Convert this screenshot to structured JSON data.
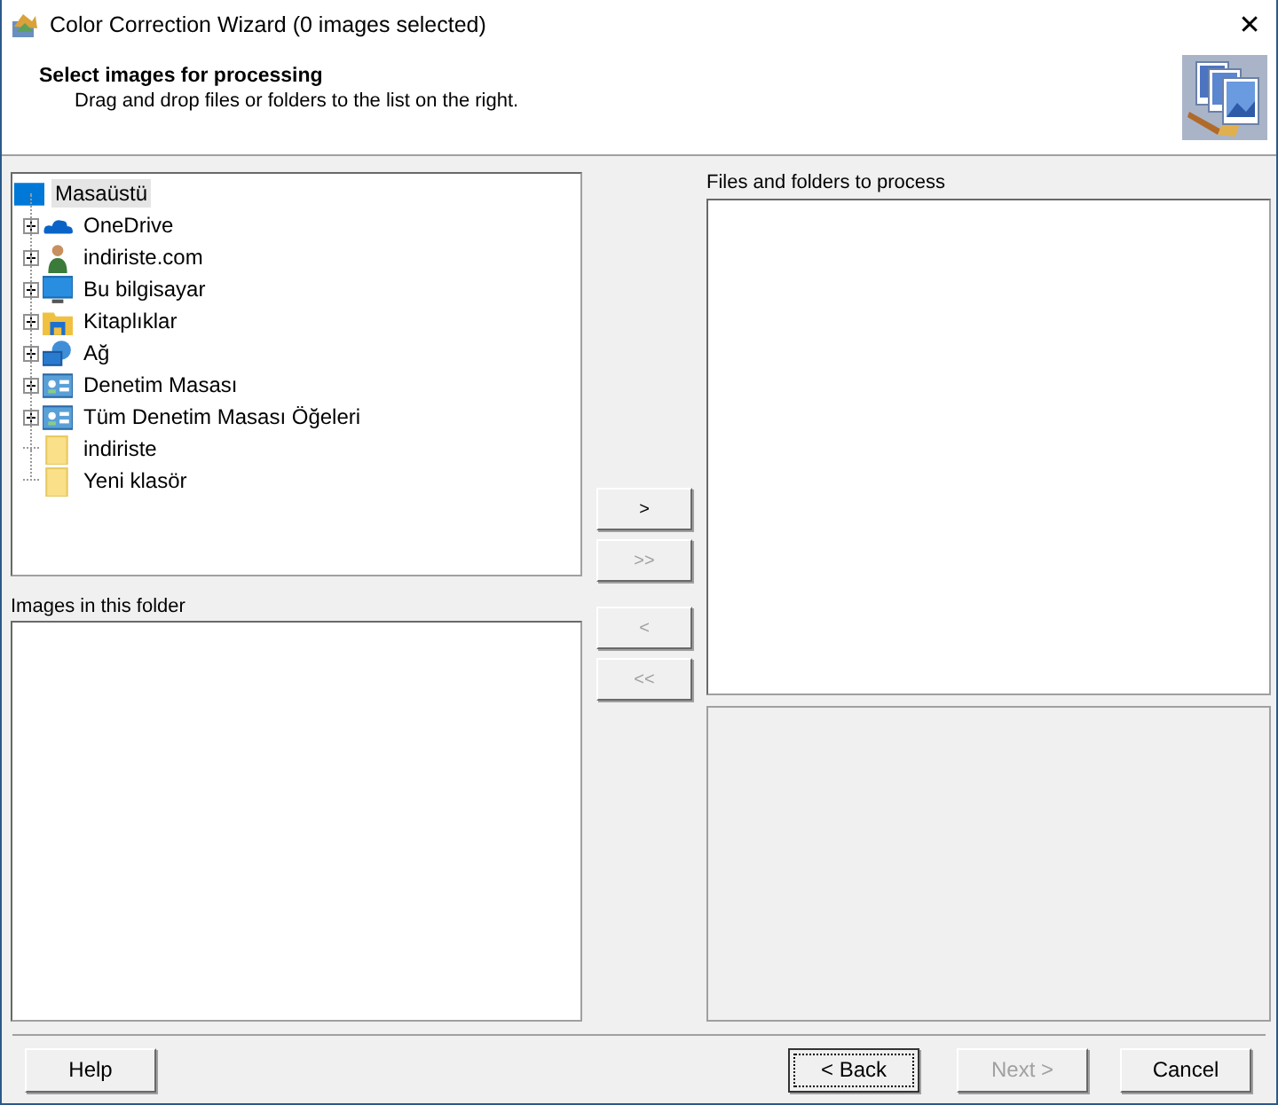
{
  "window": {
    "title": "Color Correction Wizard (0 images selected)",
    "close": "✕"
  },
  "header": {
    "title": "Select images for processing",
    "subtitle": "Drag and drop files or folders to the list on the right."
  },
  "tree": {
    "root": {
      "label": "Masaüstü",
      "selected": true
    },
    "children": [
      {
        "label": "OneDrive",
        "kind": "cloud",
        "expandable": true
      },
      {
        "label": "indiriste.com",
        "kind": "user",
        "expandable": true
      },
      {
        "label": "Bu bilgisayar",
        "kind": "computer",
        "expandable": true
      },
      {
        "label": "Kitaplıklar",
        "kind": "library",
        "expandable": true
      },
      {
        "label": "Ağ",
        "kind": "network",
        "expandable": true
      },
      {
        "label": "Denetim Masası",
        "kind": "settings",
        "expandable": true
      },
      {
        "label": "Tüm Denetim Masası Öğeleri",
        "kind": "settings",
        "expandable": true
      },
      {
        "label": "indiriste",
        "kind": "folder",
        "expandable": false
      },
      {
        "label": "Yeni klasör",
        "kind": "folder",
        "expandable": false
      }
    ]
  },
  "images_label": "Images in this folder",
  "files_label": "Files and folders to process",
  "transfer_buttons": [
    {
      "label": ">",
      "disabled": false
    },
    {
      "label": ">>",
      "disabled": true
    },
    {
      "label": "<",
      "disabled": true
    },
    {
      "label": "<<",
      "disabled": true
    }
  ],
  "footer": {
    "help": {
      "label": "Help",
      "disabled": false
    },
    "buttons": [
      {
        "label": "< Back",
        "disabled": false,
        "focused": true
      },
      {
        "label": "Next >",
        "disabled": true,
        "focused": false
      },
      {
        "label": "Cancel",
        "disabled": false,
        "focused": false
      }
    ]
  }
}
